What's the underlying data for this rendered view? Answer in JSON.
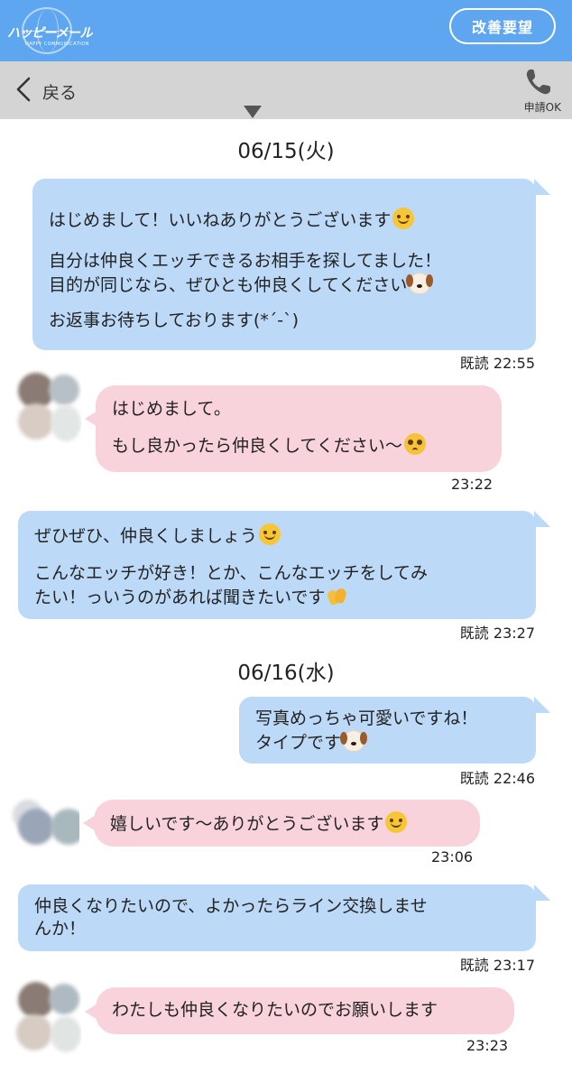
{
  "header": {
    "logo_text": "ハッピーメール",
    "logo_sub": "HAPPY COMMUNICATION",
    "improve_button": "改善要望"
  },
  "nav": {
    "back_label": "戻る",
    "phone_label": "申請OK"
  },
  "dates": {
    "d1": "06/15(火)",
    "d2": "06/16(水)"
  },
  "messages": {
    "m1": {
      "p1": "はじめまして！いいねありがとうございます",
      "p2a": "自分は仲良くエッチできるお相手を探してました！",
      "p2b": "目的が同じなら、ぜひとも仲良くしてください",
      "p3": "お返事お待ちしております(*´-`)",
      "meta": "既読  22:55"
    },
    "m2": {
      "p1": "はじめまして。",
      "p2": "もし良かったら仲良くしてください〜",
      "meta": "23:22"
    },
    "m3": {
      "p1": "ぜひぜひ、仲良くしましょう",
      "p2a": "こんなエッチが好き！とか、こんなエッチをしてみ",
      "p2b": "たい！っいうのがあれば聞きたいです",
      "meta": "既読  23:27"
    },
    "m4": {
      "p1": "写真めっちゃ可愛いですね！",
      "p2": "タイプです",
      "meta": "既読  22:46"
    },
    "m5": {
      "p1": "嬉しいです〜ありがとうございます",
      "meta": "23:06"
    },
    "m6": {
      "p1a": "仲良くなりたいので、よかったらライン交換しませ",
      "p1b": "んか！",
      "meta": "既読  23:17"
    },
    "m7": {
      "p1": "わたしも仲良くなりたいのでお願いします",
      "meta": "23:23"
    }
  },
  "colors": {
    "header_blue": "#5ea6f0",
    "nav_gray": "#d4d4d4",
    "outgoing_bubble": "#bcd9f7",
    "incoming_bubble": "#f9d3dc"
  },
  "icons": {
    "back": "chevron-left-icon",
    "phone": "phone-icon",
    "emoji_smile": "smiling-face-emoji",
    "emoji_dog": "dog-face-emoji",
    "emoji_pleading": "pleading-face-emoji",
    "emoji_relieved": "relieved-face-emoji",
    "emoji_clap": "clapping-hands-emoji",
    "emoji_blush": "blushing-face-emoji"
  }
}
